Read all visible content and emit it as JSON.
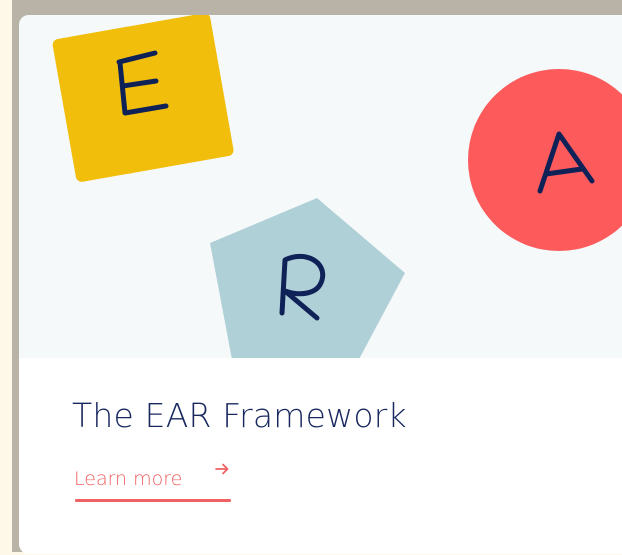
{
  "card": {
    "title": "The EAR Framework",
    "link_label": "Learn more",
    "link_icon": "arrow-right-icon"
  },
  "hero": {
    "background": "#f5f9fa",
    "shapes": [
      {
        "name": "square",
        "letter": "E",
        "color": "#f2be0c"
      },
      {
        "name": "circle",
        "letter": "A",
        "color": "#fd5a5c"
      },
      {
        "name": "pentagon",
        "letter": "R",
        "color": "#b0d0d8"
      }
    ],
    "letter_color": "#0f2258"
  },
  "colors": {
    "accent": "#f06161",
    "title": "#18275e"
  }
}
